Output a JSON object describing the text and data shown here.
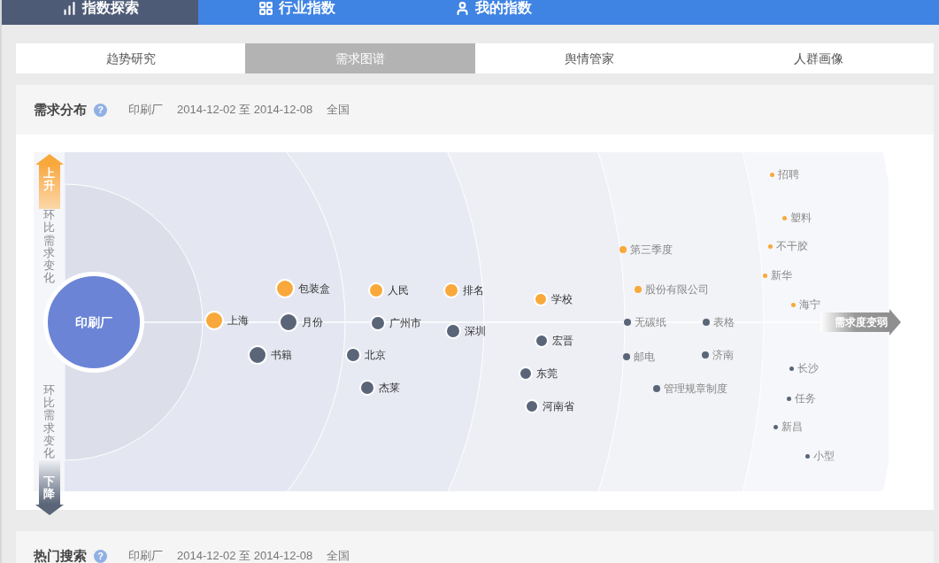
{
  "nav": [
    {
      "label": "指数探索",
      "selected": true
    },
    {
      "label": "行业指数",
      "selected": false
    },
    {
      "label": "我的指数",
      "selected": false
    }
  ],
  "tabs": [
    {
      "label": "趋势研究",
      "selected": false
    },
    {
      "label": "需求图谱",
      "selected": true
    },
    {
      "label": "舆情管家",
      "selected": false
    },
    {
      "label": "人群画像",
      "selected": false
    }
  ],
  "demand_panel": {
    "title": "需求分布",
    "help": "?",
    "keyword": "印刷厂",
    "date_range": "2014-12-02 至 2014-12-08",
    "region": "全国",
    "chart": {
      "center": "印刷厂",
      "up_label": "上升",
      "down_label": "下降",
      "axis_label_top": "环比需求变化",
      "axis_label_bottom": "环比需求变化",
      "weaker_label": "需求度变弱",
      "rings": [
        {
          "nodes": [
            {
              "label": "上海",
              "color": "#f9a83b"
            },
            {
              "label": "包装盒",
              "color": "#f9a83b"
            },
            {
              "label": "月份",
              "color": "#5a6578"
            },
            {
              "label": "书籍",
              "color": "#5a6578"
            }
          ]
        },
        {
          "nodes": [
            {
              "label": "人民",
              "color": "#f9a83b"
            },
            {
              "label": "排名",
              "color": "#f9a83b"
            },
            {
              "label": "广州市",
              "color": "#5a6578"
            },
            {
              "label": "深圳",
              "color": "#5a6578"
            },
            {
              "label": "北京",
              "color": "#5a6578"
            },
            {
              "label": "杰莱",
              "color": "#5a6578"
            }
          ]
        },
        {
          "nodes": [
            {
              "label": "学校",
              "color": "#f9a83b"
            },
            {
              "label": "宏晋",
              "color": "#5a6578"
            },
            {
              "label": "东莞",
              "color": "#5a6578"
            },
            {
              "label": "河南省",
              "color": "#5a6578"
            }
          ]
        },
        {
          "nodes": [
            {
              "label": "第三季度",
              "color": "#f9a83b"
            },
            {
              "label": "股份有限公司",
              "color": "#f9a83b"
            },
            {
              "label": "无碳纸",
              "color": "#5a6578"
            },
            {
              "label": "表格",
              "color": "#5a6578"
            },
            {
              "label": "邮电",
              "color": "#5a6578"
            },
            {
              "label": "济南",
              "color": "#5a6578"
            },
            {
              "label": "管理规章制度",
              "color": "#5a6578"
            }
          ]
        },
        {
          "nodes": [
            {
              "label": "招聘",
              "color": "#f9a83b"
            },
            {
              "label": "塑料",
              "color": "#f9a83b"
            },
            {
              "label": "不干胶",
              "color": "#f9a83b"
            },
            {
              "label": "新华",
              "color": "#f9a83b"
            },
            {
              "label": "海宁",
              "color": "#f9a83b"
            },
            {
              "label": "长沙",
              "color": "#5a6578"
            },
            {
              "label": "任务",
              "color": "#5a6578"
            },
            {
              "label": "新昌",
              "color": "#5a6578"
            },
            {
              "label": "小型",
              "color": "#5a6578"
            }
          ]
        }
      ]
    }
  },
  "search_panel": {
    "title": "热门搜索",
    "help": "?",
    "keyword": "印刷厂",
    "date_range": "2014-12-02 至 2014-12-08",
    "region": "全国"
  }
}
